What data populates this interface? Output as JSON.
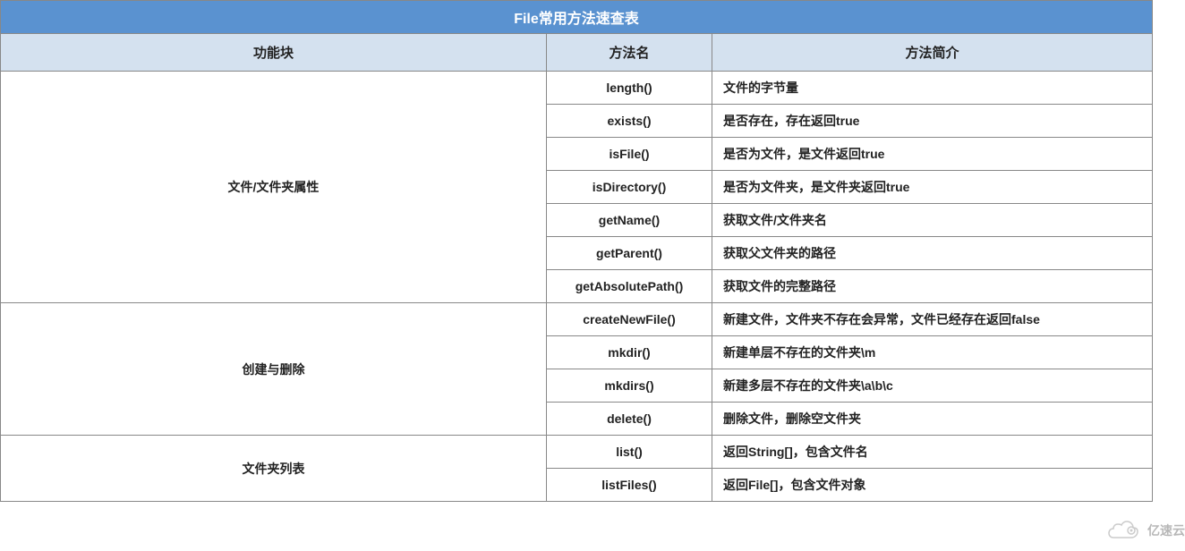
{
  "table": {
    "title": "File常用方法速查表",
    "headers": {
      "group": "功能块",
      "method": "方法名",
      "description": "方法简介"
    },
    "groups": [
      {
        "name": "文件/文件夹属性",
        "rows": [
          {
            "method": "length()",
            "description": "文件的字节量"
          },
          {
            "method": "exists()",
            "description": "是否存在，存在返回true"
          },
          {
            "method": "isFile()",
            "description": "是否为文件，是文件返回true"
          },
          {
            "method": "isDirectory()",
            "description": "是否为文件夹，是文件夹返回true"
          },
          {
            "method": "getName()",
            "description": "获取文件/文件夹名"
          },
          {
            "method": "getParent()",
            "description": "获取父文件夹的路径"
          },
          {
            "method": "getAbsolutePath()",
            "description": "获取文件的完整路径"
          }
        ]
      },
      {
        "name": "创建与删除",
        "rows": [
          {
            "method": "createNewFile()",
            "description": "新建文件，文件夹不存在会异常，文件已经存在返回false"
          },
          {
            "method": "mkdir()",
            "description": "新建单层不存在的文件夹\\m"
          },
          {
            "method": "mkdirs()",
            "description": "新建多层不存在的文件夹\\a\\b\\c"
          },
          {
            "method": "delete()",
            "description": "删除文件，删除空文件夹"
          }
        ]
      },
      {
        "name": "文件夹列表",
        "rows": [
          {
            "method": "list()",
            "description": "返回String[]，包含文件名"
          },
          {
            "method": "listFiles()",
            "description": "返回File[]，包含文件对象"
          }
        ]
      }
    ]
  },
  "watermark": {
    "brand": "亿速云"
  }
}
